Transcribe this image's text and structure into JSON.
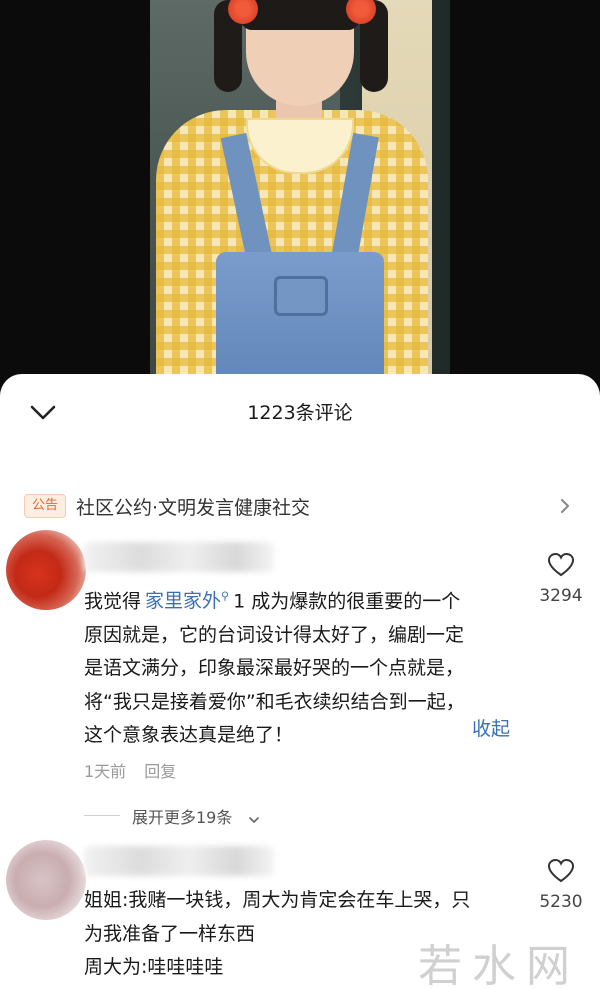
{
  "sheet": {
    "title": "1223条评论",
    "notice": {
      "badge": "公告",
      "text": "社区公约·文明发言健康社交"
    }
  },
  "comments": [
    {
      "lines": [
        {
          "pre": "我觉得",
          "mention": "家里家外",
          "post": "1 成为爆款的很重要的一个"
        },
        "原因就是，它的台词设计得太好了，编剧一定",
        "是语文满分，印象最深最好哭的一个点就是，",
        "将“我只是接着爱你”和毛衣续织结合到一起，",
        "这个意象表达真是绝了！"
      ],
      "collapse_label": "收起",
      "likes": "3294",
      "time": "1天前",
      "reply_label": "回复",
      "expand_label": "展开更多19条"
    },
    {
      "lines": [
        "姐姐:我赌一块钱，周大为肯定会在车上哭，只",
        "为我准备了一样东西",
        "周大为:哇哇哇哇"
      ],
      "likes": "5230"
    }
  ],
  "watermark": "若水网",
  "colors": {
    "link": "#3b6fb6",
    "badge": "#e06a2c",
    "meta": "#9a9a9a"
  },
  "icons": [
    "chevron-down-icon",
    "chevron-right-icon",
    "heart-icon"
  ]
}
